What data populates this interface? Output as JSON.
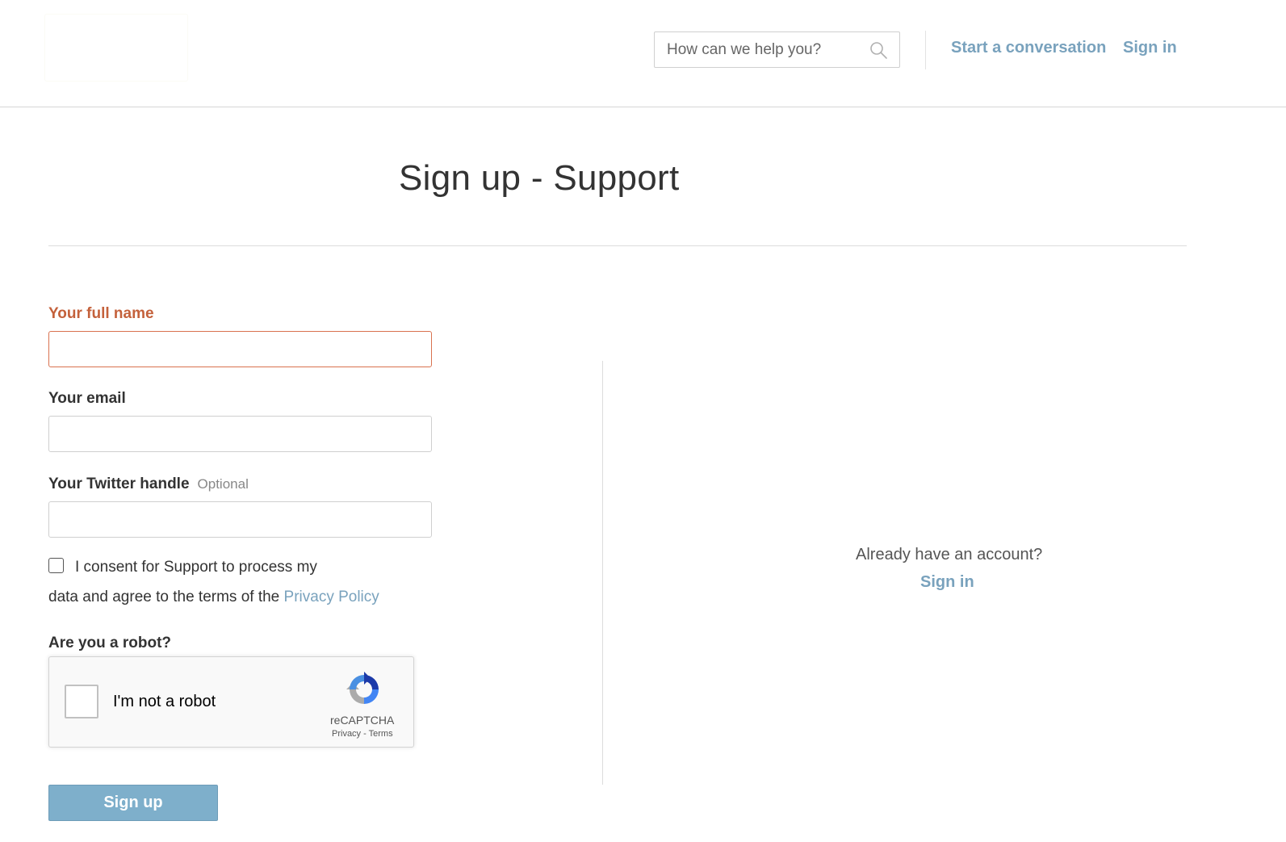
{
  "header": {
    "search_placeholder": "How can we help you?",
    "search_icon": "search-icon",
    "start_conversation": "Start a conversation",
    "sign_in": "Sign in"
  },
  "page": {
    "title": "Sign up - Support"
  },
  "form": {
    "full_name_label": "Your full name",
    "email_label": "Your email",
    "twitter_label": "Your Twitter handle",
    "twitter_optional": "Optional",
    "consent_text_line1": "I consent for Support to process my",
    "consent_text_line2": "data and agree to the terms of the ",
    "privacy_link": "Privacy Policy",
    "robot_label": "Are you a robot?",
    "submit_label": "Sign up"
  },
  "captcha": {
    "checkbox_label": "I'm not a robot",
    "brand": "reCAPTCHA",
    "privacy": "Privacy",
    "separator": " - ",
    "terms": "Terms"
  },
  "aside": {
    "already_text": "Already have an account?",
    "sign_in": "Sign in"
  },
  "colors": {
    "link": "#79a2bd",
    "error": "#c4613b",
    "button": "#7eafcb"
  }
}
